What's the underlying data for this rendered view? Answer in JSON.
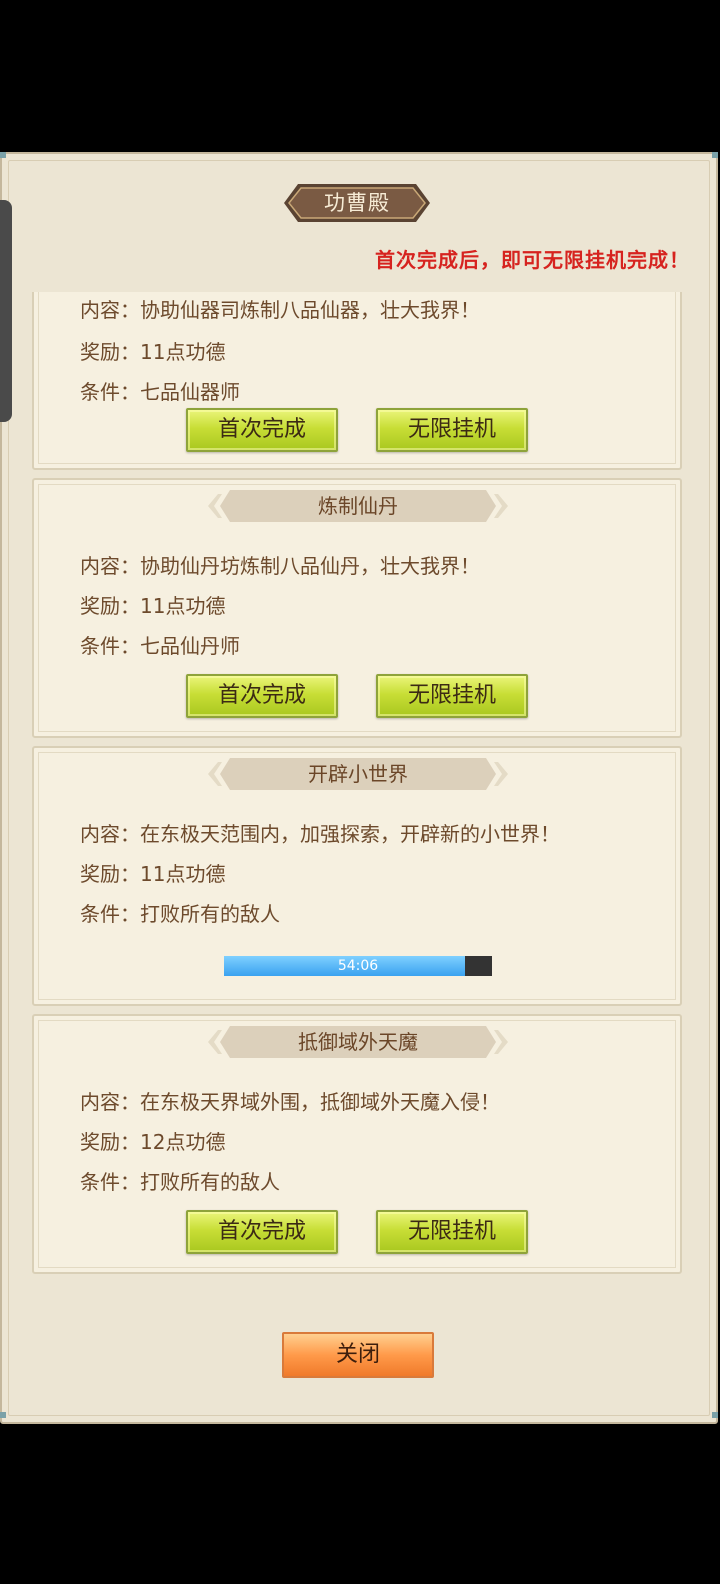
{
  "dialog": {
    "title": "功曹殿",
    "notice": "首次完成后，即可无限挂机完成！",
    "close_label": "关闭"
  },
  "tasks": [
    {
      "content": "内容：协助仙器司炼制八品仙器，壮大我界！",
      "reward": "奖励：11点功德",
      "condition": "条件：七品仙器师",
      "first_label": "首次完成",
      "idle_label": "无限挂机"
    },
    {
      "name": "炼制仙丹",
      "content": "内容：协助仙丹坊炼制八品仙丹，壮大我界！",
      "reward": "奖励：11点功德",
      "condition": "条件：七品仙丹师",
      "first_label": "首次完成",
      "idle_label": "无限挂机"
    },
    {
      "name": "开辟小世界",
      "content": "内容：在东极天范围内，加强探索，开辟新的小世界！",
      "reward": "奖励：11点功德",
      "condition": "条件：打败所有的敌人",
      "progress_text": "54:06",
      "progress_fraction": 0.9
    },
    {
      "name": "抵御域外天魔",
      "content": "内容：在东极天界域外围，抵御域外天魔入侵！",
      "reward": "奖励：12点功德",
      "condition": "条件：打败所有的敌人",
      "first_label": "首次完成",
      "idle_label": "无限挂机"
    }
  ],
  "colors": {
    "accent_green": "#c8de36",
    "notice_red": "#d6231f",
    "close_orange": "#ff9a4a",
    "progress_blue": "#3aa2f0"
  }
}
